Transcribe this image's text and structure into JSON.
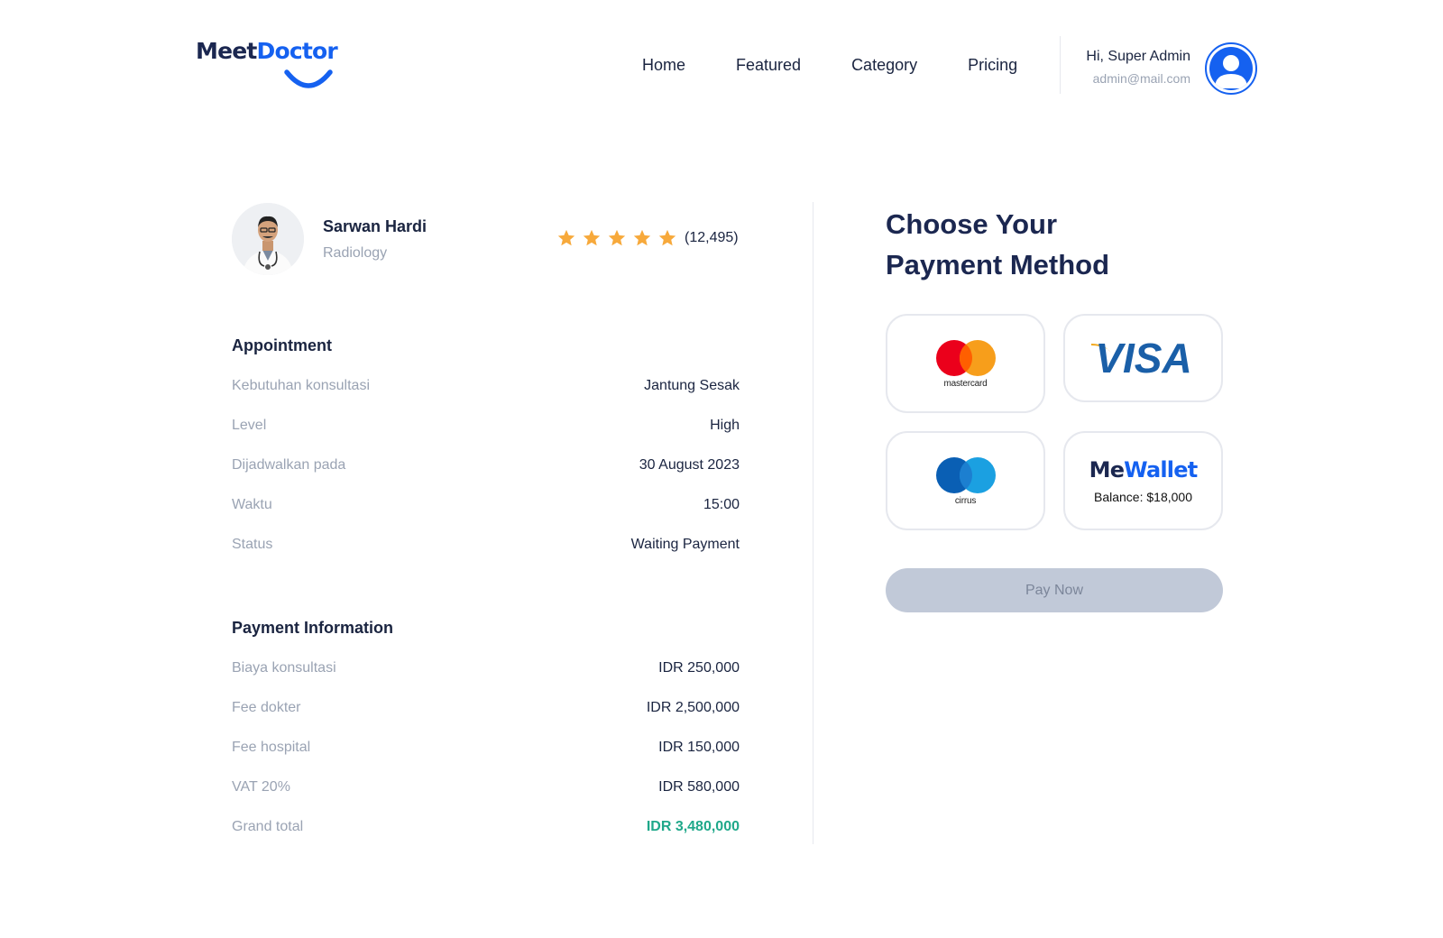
{
  "brand": {
    "logo_part1": "Meet",
    "logo_part2": "Doctor"
  },
  "nav": {
    "items": [
      "Home",
      "Featured",
      "Category",
      "Pricing"
    ]
  },
  "user": {
    "greeting": "Hi, Super Admin",
    "email": "admin@mail.com"
  },
  "doctor": {
    "name": "Sarwan Hardi",
    "specialty": "Radiology",
    "rating_stars": 5,
    "review_count": "(12,495)"
  },
  "appointment": {
    "title": "Appointment",
    "rows": [
      {
        "label": "Kebutuhan konsultasi",
        "value": "Jantung Sesak"
      },
      {
        "label": "Level",
        "value": "High"
      },
      {
        "label": "Dijadwalkan pada",
        "value": "30 August 2023"
      },
      {
        "label": "Waktu",
        "value": "15:00"
      },
      {
        "label": "Status",
        "value": "Waiting Payment"
      }
    ]
  },
  "payment_info": {
    "title": "Payment Information",
    "rows": [
      {
        "label": "Biaya konsultasi",
        "value": "IDR 250,000"
      },
      {
        "label": "Fee dokter",
        "value": "IDR 2,500,000"
      },
      {
        "label": "Fee hospital",
        "value": "IDR 150,000"
      },
      {
        "label": "VAT 20%",
        "value": "IDR 580,000"
      },
      {
        "label": "Grand total",
        "value": "IDR 3,480,000"
      }
    ]
  },
  "payment_method": {
    "title_line1": "Choose Your",
    "title_line2": "Payment Method",
    "options": {
      "mastercard": "mastercard",
      "visa": "VISA",
      "cirrus": "cirrus",
      "wallet_me": "Me",
      "wallet_wallet": "Wallet",
      "wallet_balance": "Balance: $18,000"
    },
    "pay_button": "Pay Now"
  },
  "colors": {
    "brand_blue": "#1561f0",
    "brand_navy": "#1b2750",
    "total_green": "#1fa88a",
    "star": "#f7a93b",
    "disabled_button": "#c1c9d8"
  }
}
